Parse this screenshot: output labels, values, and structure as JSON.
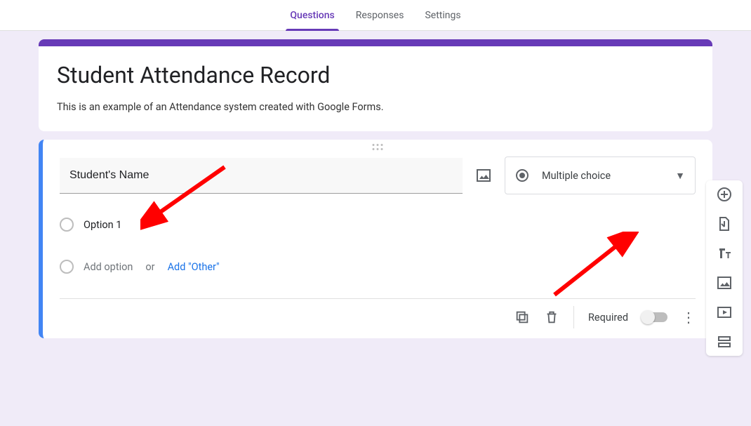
{
  "tabs": {
    "questions": "Questions",
    "responses": "Responses",
    "settings": "Settings"
  },
  "header": {
    "title": "Student Attendance Record",
    "description": "This is an example of an Attendance system created with Google Forms."
  },
  "question": {
    "title": "Student's Name",
    "type_label": "Multiple choice",
    "options": [
      "Option 1"
    ],
    "add_option": "Add option",
    "or": "or",
    "add_other": "Add \"Other\""
  },
  "footer": {
    "required_label": "Required"
  },
  "icons": {
    "add": "add-circle",
    "import": "import-doc",
    "text": "title-text",
    "image": "image",
    "video": "video",
    "section": "section"
  }
}
